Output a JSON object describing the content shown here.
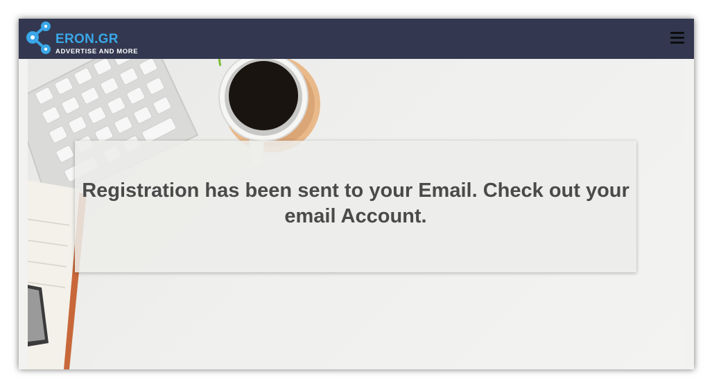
{
  "header": {
    "logo_title": "ERON.GR",
    "logo_tagline": "ADVERTISE AND MORE",
    "menu_icon": "hamburger-menu-icon",
    "background_color": "#333850"
  },
  "hero": {
    "message_prefix": "Registration has been sent to your Email.",
    "message_link": "Check out your email Account",
    "message_suffix": ".",
    "link_underline_color": "#22e822",
    "image_description_icons": [
      "keyboard-image",
      "coffee-cup-image",
      "notebook-image"
    ]
  }
}
